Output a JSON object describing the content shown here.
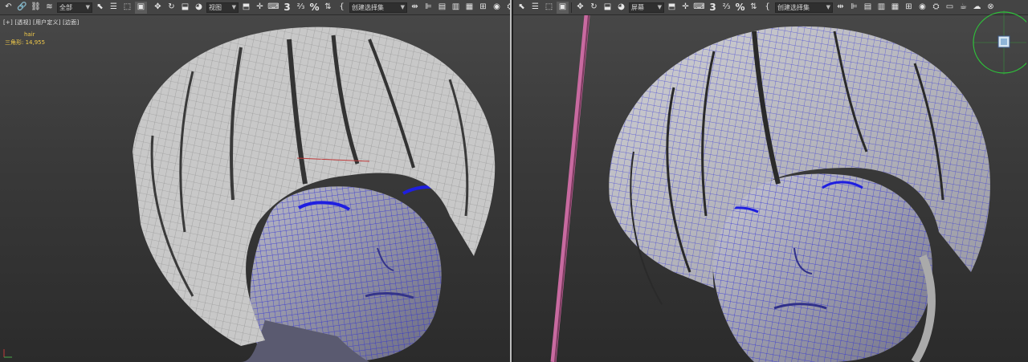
{
  "left_view": {
    "toolbar": {
      "filter_value": "全部",
      "view_value": "视图",
      "snap_label": "3",
      "angle_label": "⅔",
      "selection_set_value": "创建选择集"
    },
    "viewport_label": "[+] [透视] [用户定义] [边面]",
    "object_name": "hair",
    "triangle_label": "三角形:",
    "triangle_count": "14,955"
  },
  "right_view": {
    "toolbar": {
      "view_value": "屏幕",
      "snap_label": "3",
      "angle_label": "⅔",
      "selection_set_value": "创建选择集"
    }
  },
  "colors": {
    "toolbar_bg": "#444444",
    "viewport_bg": "#3a3a3a",
    "wire_blue": "#2a2ad8",
    "info_text": "#f0c94a",
    "separator_pink": "#c06090",
    "gizmo_green": "#2ec23a"
  },
  "icons": {
    "view_cube": "view-cube-icon",
    "select": "select-arrow-icon",
    "move": "move-icon",
    "rotate": "rotate-icon",
    "scale": "scale-icon"
  }
}
